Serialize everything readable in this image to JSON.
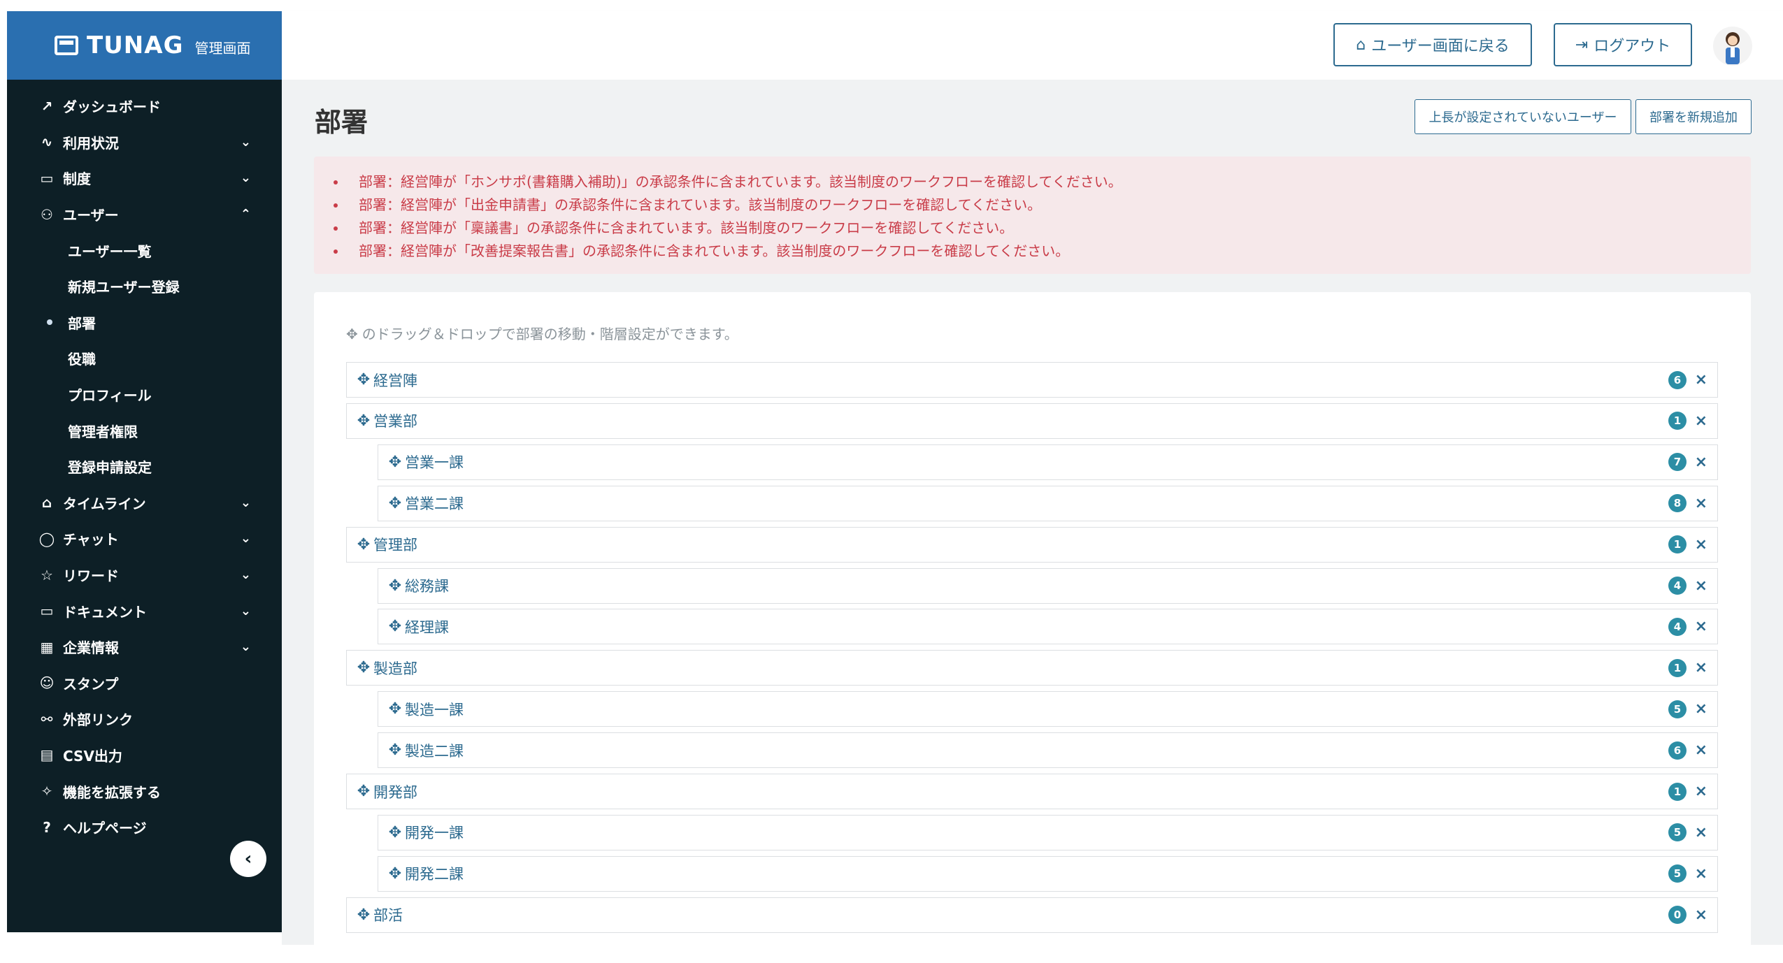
{
  "brand": {
    "name": "TUNAG",
    "sub": "管理画面"
  },
  "sidebar": {
    "items": [
      {
        "label": "ダッシュボード",
        "icon": "chart-icon",
        "glyph": "↗",
        "chevron": ""
      },
      {
        "label": "利用状況",
        "icon": "activity-icon",
        "glyph": "∿",
        "chevron": "⌄"
      },
      {
        "label": "制度",
        "icon": "book-icon",
        "glyph": "▭",
        "chevron": "⌄"
      },
      {
        "label": "ユーザー",
        "icon": "users-icon",
        "glyph": "⚇",
        "chevron": "⌃"
      },
      {
        "label": "タイムライン",
        "icon": "home-icon",
        "glyph": "⌂",
        "chevron": "⌄"
      },
      {
        "label": "チャット",
        "icon": "chat-icon",
        "glyph": "◯",
        "chevron": "⌄"
      },
      {
        "label": "リワード",
        "icon": "star-icon",
        "glyph": "☆",
        "chevron": "⌄"
      },
      {
        "label": "ドキュメント",
        "icon": "folder-icon",
        "glyph": "▭",
        "chevron": "⌄"
      },
      {
        "label": "企業情報",
        "icon": "building-icon",
        "glyph": "▦",
        "chevron": "⌄"
      },
      {
        "label": "スタンプ",
        "icon": "smile-icon",
        "glyph": "☺",
        "chevron": ""
      },
      {
        "label": "外部リンク",
        "icon": "link-icon",
        "glyph": "⚯",
        "chevron": ""
      },
      {
        "label": "CSV出力",
        "icon": "table-icon",
        "glyph": "▤",
        "chevron": ""
      },
      {
        "label": "機能を拡張する",
        "icon": "sparkle-icon",
        "glyph": "✧",
        "chevron": ""
      },
      {
        "label": "ヘルプページ",
        "icon": "help-icon",
        "glyph": "?",
        "chevron": ""
      }
    ],
    "subitems": [
      "ユーザー一覧",
      "新規ユーザー登録",
      "部署",
      "役職",
      "プロフィール",
      "管理者権限",
      "登録申請設定"
    ],
    "active_sub": "部署",
    "collapse_glyph": "‹"
  },
  "header": {
    "back_button": "ユーザー画面に戻る",
    "logout_button": "ログアウト"
  },
  "page": {
    "title": "部署",
    "no_manager_button": "上長が設定されていないユーザー",
    "add_dept_button": "部署を新規追加"
  },
  "alerts": [
    "部署：経営陣が「ホンサポ(書籍購入補助)」の承認条件に含まれています。該当制度のワークフローを確認してください。",
    "部署：経営陣が「出金申請書」の承認条件に含まれています。該当制度のワークフローを確認してください。",
    "部署：経営陣が「稟議書」の承認条件に含まれています。該当制度のワークフローを確認してください。",
    "部署：経営陣が「改善提案報告書」の承認条件に含まれています。該当制度のワークフローを確認してください。"
  ],
  "hint": "のドラッグ＆ドロップで部署の移動・階層設定ができます。",
  "departments": [
    {
      "name": "経営陣",
      "count": "6",
      "level": 0
    },
    {
      "name": "営業部",
      "count": "1",
      "level": 0
    },
    {
      "name": "営業一課",
      "count": "7",
      "level": 1
    },
    {
      "name": "営業二課",
      "count": "8",
      "level": 1
    },
    {
      "name": "管理部",
      "count": "1",
      "level": 0
    },
    {
      "name": "総務課",
      "count": "4",
      "level": 1
    },
    {
      "name": "経理課",
      "count": "4",
      "level": 1
    },
    {
      "name": "製造部",
      "count": "1",
      "level": 0
    },
    {
      "name": "製造一課",
      "count": "5",
      "level": 1
    },
    {
      "name": "製造二課",
      "count": "6",
      "level": 1
    },
    {
      "name": "開発部",
      "count": "1",
      "level": 0
    },
    {
      "name": "開発一課",
      "count": "5",
      "level": 1
    },
    {
      "name": "開発二課",
      "count": "5",
      "level": 1
    },
    {
      "name": "部活",
      "count": "0",
      "level": 0
    }
  ]
}
